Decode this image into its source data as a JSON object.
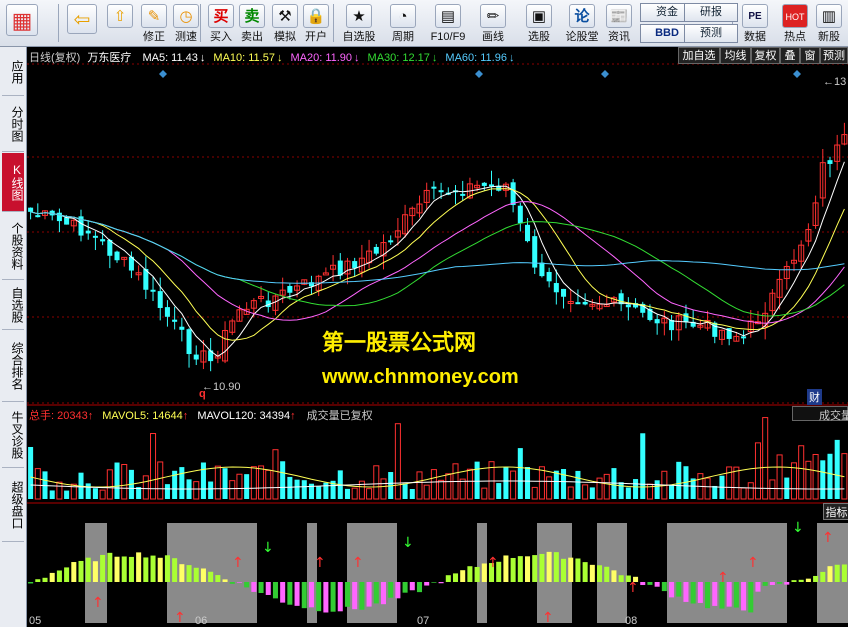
{
  "toolbar": {
    "buttons": [
      {
        "name": "color-scheme-button",
        "icon": "color-grid-icon",
        "label": ""
      },
      {
        "name": "back-button",
        "icon": "arrow-left-icon",
        "label": ""
      },
      {
        "name": "page-up-button",
        "icon": "arrow-up-icon",
        "label": ""
      },
      {
        "name": "revise-button",
        "icon": "edit-circle-icon",
        "label": "修正"
      },
      {
        "name": "test-speed-button",
        "icon": "clock-icon",
        "label": "测速"
      },
      {
        "name": "buy-button",
        "icon": "buy-icon",
        "label": "买入",
        "glyph": "买"
      },
      {
        "name": "sell-button",
        "icon": "sell-icon",
        "label": "卖出",
        "glyph": "卖"
      },
      {
        "name": "simulate-button",
        "icon": "hammer-icon",
        "label": "模拟"
      },
      {
        "name": "open-account-button",
        "icon": "lock-icon",
        "label": "开户"
      },
      {
        "name": "watchlist-button",
        "icon": "star-window-icon",
        "label": "自选股"
      },
      {
        "name": "period-button",
        "icon": "clock-dropdown-icon",
        "label": "周期"
      },
      {
        "name": "f10-button",
        "icon": "f10-icon",
        "label": "F10/F9"
      },
      {
        "name": "draw-button",
        "icon": "pencil-icon",
        "label": "画线"
      },
      {
        "name": "stock-picker-button",
        "icon": "stock-picker-icon",
        "label": "选股"
      },
      {
        "name": "forum-button",
        "icon": "forum-icon",
        "label": "论股堂",
        "glyph": "论"
      },
      {
        "name": "news-button",
        "icon": "news-icon",
        "label": "资讯"
      },
      {
        "name": "data-button",
        "icon": "pe-icon",
        "label": "数据",
        "glyph": "PE"
      },
      {
        "name": "hot-button",
        "icon": "fire-icon",
        "label": "热点",
        "glyph": "HOT"
      },
      {
        "name": "new-stock-button",
        "icon": "new-stock-icon",
        "label": "新股"
      }
    ],
    "box_buttons": [
      {
        "name": "capital-button",
        "label": "资金"
      },
      {
        "name": "bbd-button",
        "label": "BBD"
      },
      {
        "name": "research-button",
        "label": "研报"
      },
      {
        "name": "forecast-button",
        "label": "预测"
      }
    ]
  },
  "sidebar": {
    "tabs": [
      {
        "name": "tab-apply",
        "label": "应用"
      },
      {
        "name": "tab-intraday",
        "label": "分时图"
      },
      {
        "name": "tab-kline",
        "label": "K线图",
        "active": true
      },
      {
        "name": "tab-stock-info",
        "label": "个股资料"
      },
      {
        "name": "tab-watchlist",
        "label": "自选股"
      },
      {
        "name": "tab-ranking",
        "label": "综合排名"
      },
      {
        "name": "tab-bull-diagnosis",
        "label": "牛叉诊股"
      },
      {
        "name": "tab-super-panel",
        "label": "超级盘口"
      }
    ]
  },
  "chart": {
    "header": {
      "period": "日线(复权)",
      "stock_name": "万东医疗",
      "ma": [
        {
          "label": "MA5: 11.43",
          "arrow": "↓",
          "color": "#ffffff"
        },
        {
          "label": "MA10: 11.57",
          "arrow": "↓",
          "color": "#ffff55"
        },
        {
          "label": "MA20: 11.90",
          "arrow": "↓",
          "color": "#ff66ff"
        },
        {
          "label": "MA30: 12.17",
          "arrow": "↓",
          "color": "#33dd33"
        },
        {
          "label": "MA60: 11.96",
          "arrow": "↓",
          "color": "#55ccff"
        }
      ]
    },
    "right_buttons": [
      "加自选",
      "均线",
      "复权",
      "叠",
      "窗",
      "预测"
    ],
    "low_label": "10.90",
    "high_label": "13",
    "q_marker": "q",
    "fin_badge": "财",
    "volume_header": {
      "total": "总手: 20343",
      "mavol5": "MAVOL5: 14644",
      "mavol120": "MAVOL120: 34394",
      "note": "成交量已复权",
      "right_label": "成交量"
    },
    "indicator_label": "指标",
    "watermark": {
      "line1": "第一股票公式网",
      "line2": "www.chnmoney.com"
    },
    "x_labels": [
      "05",
      "06",
      "07",
      "08"
    ],
    "colors": {
      "up": "#ff3030",
      "down": "#33ffff",
      "ma5": "#ffffff",
      "ma10": "#ffff55",
      "ma20": "#ff66ff",
      "ma30": "#33dd33",
      "ma60": "#55ccff",
      "grid": "#8b0000",
      "gray": "#8a8a8a"
    }
  }
}
